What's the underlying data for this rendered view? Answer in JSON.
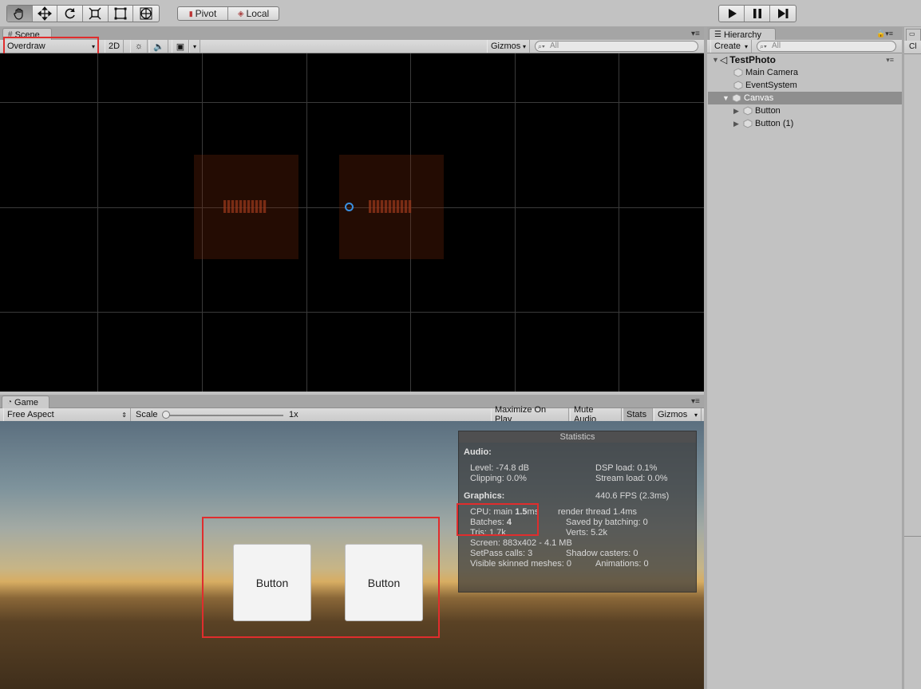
{
  "toolbar": {
    "tools": [
      "hand-tool",
      "move-tool",
      "rotate-tool",
      "scale-tool",
      "rect-tool",
      "transform-tool"
    ],
    "pivot_label": "Pivot",
    "local_label": "Local",
    "play_controls": [
      "play",
      "pause",
      "step"
    ]
  },
  "scene": {
    "tab_label": "Scene",
    "draw_mode": "Overdraw",
    "mode_2d": "2D",
    "gizmos_label": "Gizmos",
    "search_placeholder": "All"
  },
  "game": {
    "tab_label": "Game",
    "aspect": "Free Aspect",
    "scale_label": "Scale",
    "scale_value": "1x",
    "maximize_label": "Maximize On Play",
    "mute_label": "Mute Audio",
    "stats_label": "Stats",
    "gizmos_label": "Gizmos",
    "buttons": [
      "Button",
      "Button"
    ],
    "statistics": {
      "title": "Statistics",
      "audio_header": "Audio:",
      "level": "Level: -74.8 dB",
      "dsp_load": "DSP load: 0.1%",
      "clipping": "Clipping: 0.0%",
      "stream_load": "Stream load: 0.0%",
      "graphics_header": "Graphics:",
      "fps": "440.6 FPS (2.3ms)",
      "cpu_prefix": "CPU: main ",
      "cpu_main": "1.5",
      "cpu_suffix": "ms",
      "render_thread": "render thread 1.4ms",
      "batches_prefix": "Batches: ",
      "batches": "4",
      "saved_batching": "Saved by batching: 0",
      "tris": "Tris: 1.7k",
      "verts": "Verts: 5.2k",
      "screen": "Screen: 883x402 - 4.1 MB",
      "setpass": "SetPass calls: 3",
      "shadow_casters": "Shadow casters: 0",
      "skinned": "Visible skinned meshes: 0",
      "animations": "Animations: 0"
    }
  },
  "hierarchy": {
    "tab_label": "Hierarchy",
    "create_label": "Create",
    "search_placeholder": "All",
    "scene_name": "TestPhoto",
    "items": [
      {
        "label": "Main Camera",
        "depth": 1,
        "expandable": false,
        "selected": false
      },
      {
        "label": "EventSystem",
        "depth": 1,
        "expandable": false,
        "selected": false
      },
      {
        "label": "Canvas",
        "depth": 1,
        "expandable": true,
        "expanded": true,
        "selected": true
      },
      {
        "label": "Button",
        "depth": 2,
        "expandable": true,
        "selected": false
      },
      {
        "label": "Button (1)",
        "depth": 2,
        "expandable": true,
        "selected": false
      }
    ]
  },
  "right_panel": {
    "tab_label": "Cl"
  }
}
